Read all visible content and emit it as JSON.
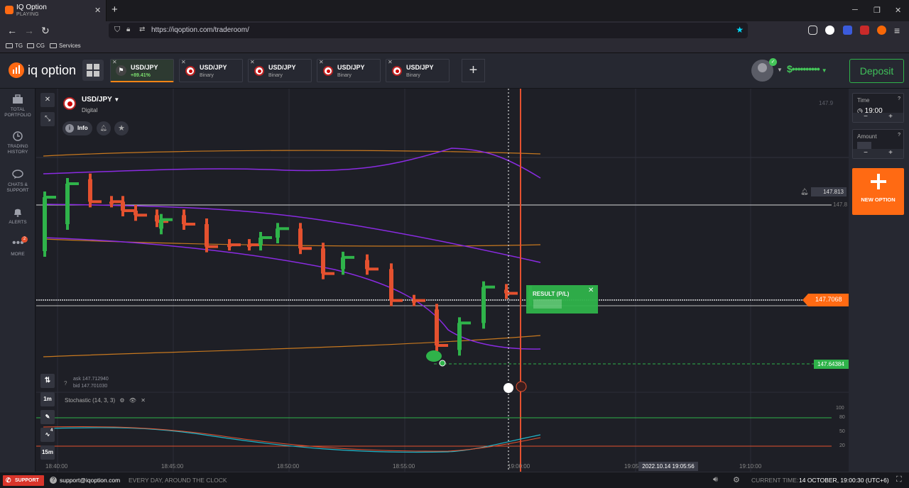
{
  "browser": {
    "tab_title": "IQ Option",
    "tab_status": "PLAYING",
    "url": "https://iqoption.com/traderoom/",
    "bookmarks": [
      "TG",
      "CG",
      "Services"
    ]
  },
  "header": {
    "logo": "iq option",
    "asset_tabs": [
      {
        "name": "USD/JPY",
        "sub": "+89.41%",
        "active": true
      },
      {
        "name": "USD/JPY",
        "sub": "Binary",
        "active": false
      },
      {
        "name": "USD/JPY",
        "sub": "Binary",
        "active": false
      },
      {
        "name": "USD/JPY",
        "sub": "Binary",
        "active": false
      },
      {
        "name": "USD/JPY",
        "sub": "Binary",
        "active": false
      }
    ],
    "balance": "$••••••••••",
    "deposit_label": "Deposit"
  },
  "sidebar": {
    "items": [
      {
        "label": "TOTAL PORTFOLIO",
        "icon": "briefcase-icon"
      },
      {
        "label": "TRADING HISTORY",
        "icon": "history-icon"
      },
      {
        "label": "CHATS & SUPPORT",
        "icon": "chat-icon"
      },
      {
        "label": "ALERTS",
        "icon": "bell-icon"
      },
      {
        "label": "MORE",
        "icon": "more-icon",
        "badge": "2"
      }
    ]
  },
  "chart_header": {
    "asset": "USD/JPY",
    "type": "Digital",
    "info_label": "Info"
  },
  "chart": {
    "price_labels": {
      "top": "147.9",
      "alert": "147.813",
      "line_1478": "147.8",
      "current": "147.7068",
      "strike": "147.64384"
    },
    "result_label": "RESULT (P/L)",
    "ask": "ask 147.712940",
    "bid": "bid 147.701030",
    "time_labels": [
      "18:40:00",
      "18:45:00",
      "18:50:00",
      "18:55:00",
      "19:00:00",
      "19:05",
      "19:10:00"
    ],
    "cursor_time": "2022.10.14 19:05:56",
    "timeframe": "1m",
    "candle_interval": "15m",
    "stochastic_label": "Stochastic (14, 3, 3)",
    "stoch_levels": [
      "100",
      "80",
      "50",
      "20"
    ],
    "badge_4": "4"
  },
  "right_panel": {
    "time_label": "Time",
    "time_value": "19:00",
    "amount_label": "Amount",
    "minus": "−",
    "plus": "+",
    "new_option": "NEW OPTION"
  },
  "footer": {
    "support": "SUPPORT",
    "email": "support@iqoption.com",
    "hours": "EVERY DAY, AROUND THE CLOCK",
    "current_time_label": "CURRENT TIME:",
    "current_time": "14 OCTOBER, 19:00:30 (UTC+6)"
  },
  "colors": {
    "bull": "#2fb34a",
    "bear": "#e4512f",
    "accent": "#ff6a13"
  },
  "chart_data": {
    "type": "candlestick",
    "candles": [
      {
        "o": 147.79,
        "c": 147.83,
        "h": 147.84,
        "l": 147.75,
        "dir": "up"
      },
      {
        "o": 147.8,
        "c": 147.83,
        "h": 147.85,
        "l": 147.79,
        "dir": "up"
      },
      {
        "o": 147.86,
        "c": 147.82,
        "h": 147.86,
        "l": 147.8,
        "dir": "down"
      },
      {
        "o": 147.82,
        "c": 147.82,
        "h": 147.83,
        "l": 147.8,
        "dir": "down"
      },
      {
        "o": 147.82,
        "c": 147.8,
        "h": 147.83,
        "l": 147.79,
        "dir": "down"
      },
      {
        "o": 147.8,
        "c": 147.79,
        "h": 147.8,
        "l": 147.78,
        "dir": "down"
      },
      {
        "o": 147.79,
        "c": 147.79,
        "h": 147.79,
        "l": 147.77,
        "dir": "down"
      },
      {
        "o": 147.79,
        "c": 147.79,
        "h": 147.8,
        "l": 147.77,
        "dir": "up"
      },
      {
        "o": 147.79,
        "c": 147.79,
        "h": 147.8,
        "l": 147.78,
        "dir": "down"
      },
      {
        "o": 147.79,
        "c": 147.77,
        "h": 147.79,
        "l": 147.76,
        "dir": "down"
      },
      {
        "o": 147.77,
        "c": 147.77,
        "h": 147.78,
        "l": 147.76,
        "dir": "down"
      },
      {
        "o": 147.78,
        "c": 147.77,
        "h": 147.78,
        "l": 147.76,
        "dir": "down"
      }
    ],
    "y_range": [
      147.62,
      147.92
    ]
  }
}
